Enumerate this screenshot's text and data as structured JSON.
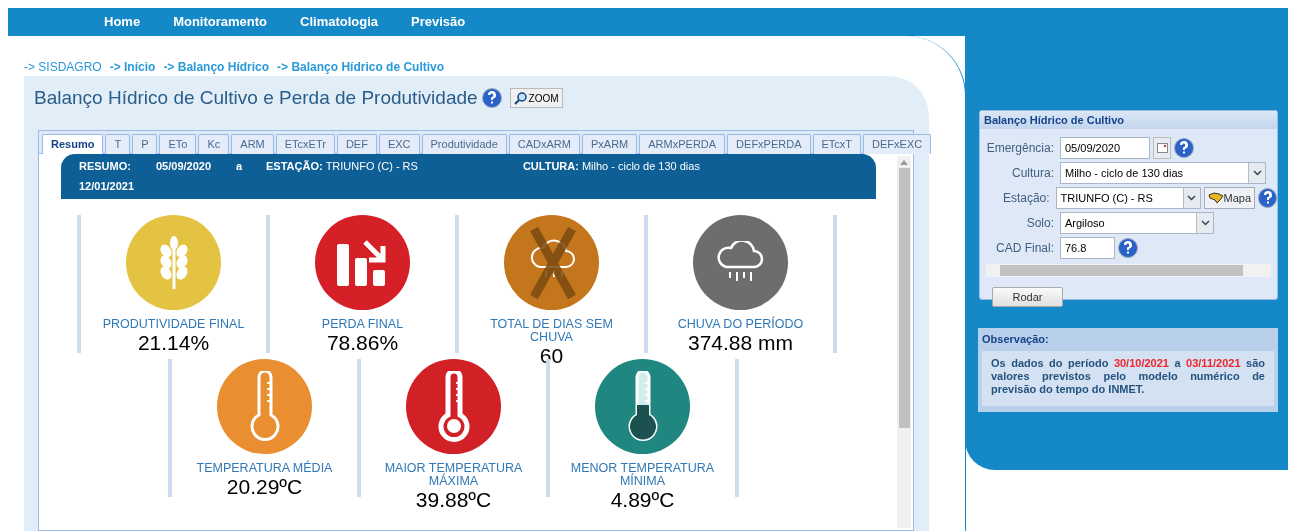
{
  "nav": [
    "Home",
    "Monitoramento",
    "Climatologia",
    "Previsão"
  ],
  "breadcrumb": [
    {
      "label": "-> SISDAGRO",
      "bold": false
    },
    {
      "label": "-> Início",
      "bold": true
    },
    {
      "label": "-> Balanço Hídrico",
      "bold": true
    },
    {
      "label": "-> Balanço Hídrico de Cultivo",
      "bold": true
    }
  ],
  "title": "Balanço Hídrico de Cultivo e Perda de Produtividade",
  "zoom_button": "ZOOM",
  "tabs": [
    {
      "label": "Resumo",
      "selected": true
    },
    {
      "label": "T",
      "selected": false
    },
    {
      "label": "P",
      "selected": false
    },
    {
      "label": "ETo",
      "selected": false
    },
    {
      "label": "Kc",
      "selected": false
    },
    {
      "label": "ARM",
      "selected": false
    },
    {
      "label": "ETcxETr",
      "selected": false
    },
    {
      "label": "DEF",
      "selected": false
    },
    {
      "label": "EXC",
      "selected": false
    },
    {
      "label": "Produtividade",
      "selected": false
    },
    {
      "label": "CADxARM",
      "selected": false
    },
    {
      "label": "PxARM",
      "selected": false
    },
    {
      "label": "ARMxPERDA",
      "selected": false
    },
    {
      "label": "DEFxPERDA",
      "selected": false
    },
    {
      "label": "ETcxT",
      "selected": false
    },
    {
      "label": "DEFxEXC",
      "selected": false
    }
  ],
  "summary": {
    "label": "RESUMO:",
    "start": "05/09/2020",
    "sep": "a",
    "end": "12/01/2021",
    "station_label": "ESTAÇÃO:",
    "station": "TRIUNFO (C) - RS",
    "crop_label": "CULTURA:",
    "crop": "Milho - ciclo de 130 dias"
  },
  "stats_row_1": [
    {
      "kind": "wheat",
      "color": "#e3c341",
      "label": "PRODUTIVIDADE FINAL",
      "value": "21.14%"
    },
    {
      "kind": "loss",
      "color": "#d62027",
      "label": "PERDA FINAL",
      "value": "78.86%"
    },
    {
      "kind": "dry",
      "color": "#c4761c",
      "label": "TOTAL DE DIAS SEM CHUVA",
      "value": "60"
    },
    {
      "kind": "rain",
      "color": "#6d6d6d",
      "label": "CHUVA DO PERÍODO",
      "value": "374.88 mm"
    }
  ],
  "stats_row_2": [
    {
      "kind": "thermo_mid",
      "color": "#e98e31",
      "label": "TEMPERATURA MÉDIA",
      "value": "20.29ºC"
    },
    {
      "kind": "thermo_max",
      "color": "#d12026",
      "label": "MAIOR TEMPERATURA MÁXIMA",
      "value": "39.88ºC"
    },
    {
      "kind": "thermo_min",
      "color": "#1f8680",
      "label": "MENOR TEMPERATURA MÍNIMA",
      "value": "4.89ºC"
    }
  ],
  "form": {
    "title": "Balanço Hídrico de Cultivo",
    "fields": [
      {
        "kind": "date",
        "label": "Emergência:",
        "value": "05/09/2020"
      },
      {
        "kind": "select",
        "label": "Cultura:",
        "value": "Milho - ciclo de 130 dias"
      },
      {
        "kind": "select_map",
        "label": "Estação:",
        "value": "TRIUNFO (C) - RS",
        "button": "Mapa"
      },
      {
        "kind": "select",
        "label": "Solo:",
        "value": "Argiloso"
      },
      {
        "kind": "number",
        "label": "CAD Final:",
        "value": "76.8"
      }
    ],
    "run_button": "Rodar"
  },
  "observation": {
    "title": "Observação:",
    "parts": [
      {
        "text": "Os dados do período ",
        "highlight": false
      },
      {
        "text": "30/10/2021",
        "highlight": true
      },
      {
        "text": " a ",
        "highlight": false
      },
      {
        "text": "03/11/2021",
        "highlight": true
      },
      {
        "text": " são valores previstos pelo modelo numérico de previsão do tempo do INMET.",
        "highlight": false
      }
    ]
  }
}
